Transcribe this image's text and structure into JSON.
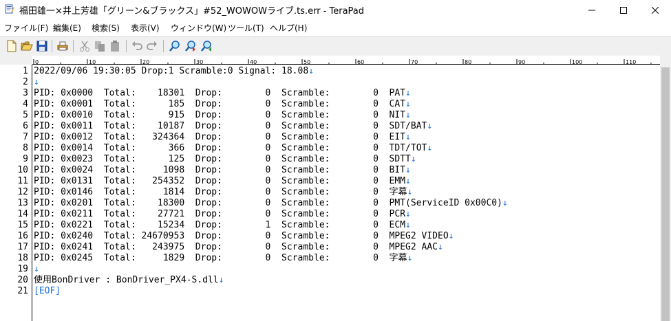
{
  "window": {
    "title": "福田雄一×井上芳雄「グリーン&ブラックス」#52_WOWOWライブ.ts.err - TeraPad",
    "controls": [
      "minimize-icon",
      "maximize-icon",
      "close-icon"
    ]
  },
  "menu": [
    {
      "label": "ファイル(F)"
    },
    {
      "label": "編集(E)"
    },
    {
      "label": "検索(S)"
    },
    {
      "label": "表示(V)"
    },
    {
      "label": "ウィンドウ(W)"
    },
    {
      "label": "ツール(T)"
    },
    {
      "label": "ヘルプ(H)"
    }
  ],
  "toolbar": [
    {
      "icon": "new-file-icon"
    },
    {
      "icon": "open-folder-icon"
    },
    {
      "icon": "save-icon"
    },
    {
      "icon": "print-icon"
    },
    {
      "icon": "cut-icon"
    },
    {
      "icon": "copy-icon"
    },
    {
      "icon": "paste-icon"
    },
    {
      "icon": "undo-icon"
    },
    {
      "icon": "redo-icon"
    },
    {
      "icon": "find-icon"
    },
    {
      "icon": "find-next-icon"
    },
    {
      "icon": "find-prev-icon"
    }
  ],
  "ruler": {
    "labels": [
      "0",
      "10",
      "20",
      "30",
      "40",
      "50",
      "60",
      "70",
      "80",
      "90",
      "100",
      "110"
    ]
  },
  "editor": {
    "lines": [
      {
        "num": "1",
        "text": "2022/09/06 19:30:05 Drop:1 Scramble:0 Signal: 18.08",
        "eol": "↓"
      },
      {
        "num": "2",
        "text": "",
        "eol": "↓"
      },
      {
        "num": "3",
        "text": "PID: 0x0000  Total:    18301  Drop:        0  Scramble:        0  PAT",
        "eol": "↓"
      },
      {
        "num": "4",
        "text": "PID: 0x0001  Total:      185  Drop:        0  Scramble:        0  CAT",
        "eol": "↓"
      },
      {
        "num": "5",
        "text": "PID: 0x0010  Total:      915  Drop:        0  Scramble:        0  NIT",
        "eol": "↓"
      },
      {
        "num": "6",
        "text": "PID: 0x0011  Total:    10187  Drop:        0  Scramble:        0  SDT/BAT",
        "eol": "↓"
      },
      {
        "num": "7",
        "text": "PID: 0x0012  Total:   324364  Drop:        0  Scramble:        0  EIT",
        "eol": "↓"
      },
      {
        "num": "8",
        "text": "PID: 0x0014  Total:      366  Drop:        0  Scramble:        0  TDT/TOT",
        "eol": "↓"
      },
      {
        "num": "9",
        "text": "PID: 0x0023  Total:      125  Drop:        0  Scramble:        0  SDTT",
        "eol": "↓"
      },
      {
        "num": "10",
        "text": "PID: 0x0024  Total:     1098  Drop:        0  Scramble:        0  BIT",
        "eol": "↓"
      },
      {
        "num": "11",
        "text": "PID: 0x0131  Total:   254352  Drop:        0  Scramble:        0  EMM",
        "eol": "↓"
      },
      {
        "num": "12",
        "text": "PID: 0x0146  Total:     1814  Drop:        0  Scramble:        0  字幕",
        "eol": "↓"
      },
      {
        "num": "13",
        "text": "PID: 0x0201  Total:    18300  Drop:        0  Scramble:        0  PMT(ServiceID 0x00C0)",
        "eol": "↓"
      },
      {
        "num": "14",
        "text": "PID: 0x0211  Total:    27721  Drop:        0  Scramble:        0  PCR",
        "eol": "↓"
      },
      {
        "num": "15",
        "text": "PID: 0x0221  Total:    15234  Drop:        1  Scramble:        0  ECM",
        "eol": "↓"
      },
      {
        "num": "16",
        "text": "PID: 0x0240  Total: 24670953  Drop:        0  Scramble:        0  MPEG2 VIDEO",
        "eol": "↓"
      },
      {
        "num": "17",
        "text": "PID: 0x0241  Total:   243975  Drop:        0  Scramble:        0  MPEG2 AAC",
        "eol": "↓"
      },
      {
        "num": "18",
        "text": "PID: 0x0245  Total:     1829  Drop:        0  Scramble:        0  字幕",
        "eol": "↓"
      },
      {
        "num": "19",
        "text": "",
        "eol": "↓"
      },
      {
        "num": "20",
        "text": "使用BonDriver : BonDriver_PX4-S.dll",
        "eol": "↓"
      },
      {
        "num": "21",
        "text": "",
        "eol": "[EOF]"
      }
    ]
  },
  "colors": {
    "eol": "#1a73d9",
    "text": "#000000",
    "toolbar_bg": "#f0f0f0"
  }
}
